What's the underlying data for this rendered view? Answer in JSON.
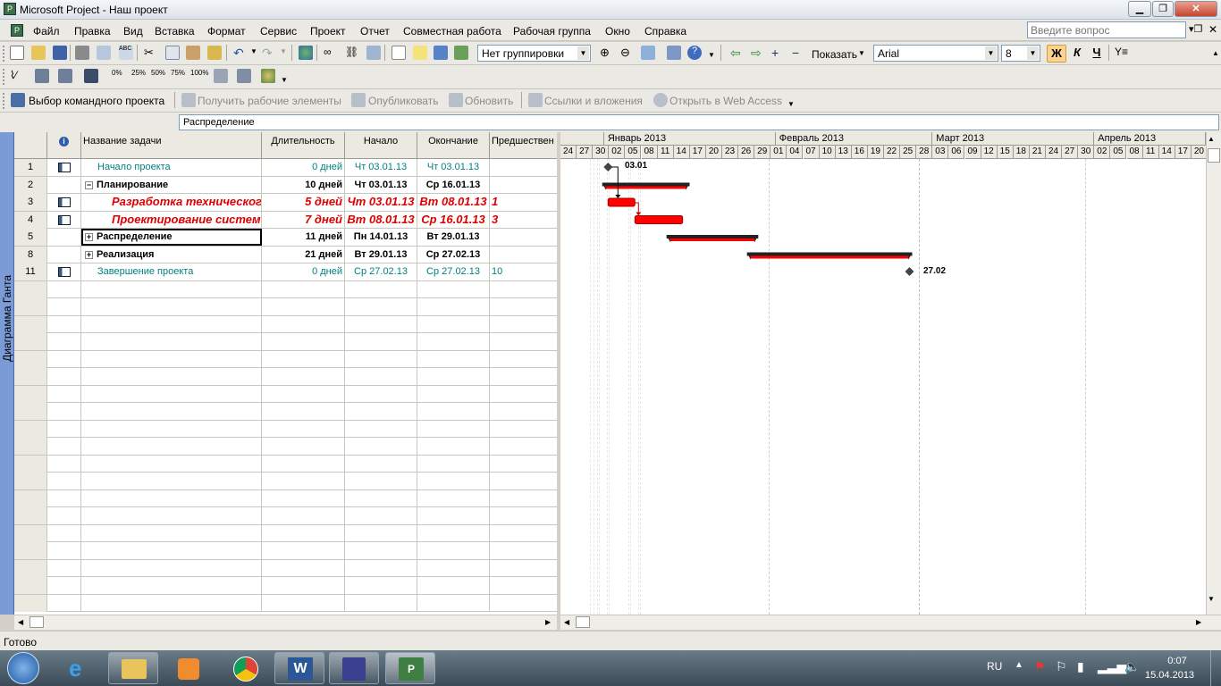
{
  "window": {
    "title": "Microsoft Project - Наш проект"
  },
  "menu": [
    "Файл",
    "Правка",
    "Вид",
    "Вставка",
    "Формат",
    "Сервис",
    "Проект",
    "Отчет",
    "Совместная работа",
    "Рабочая группа",
    "Окно",
    "Справка"
  ],
  "help_box": {
    "placeholder": "Введите вопрос"
  },
  "toolbar": {
    "grouping": "Нет группировки",
    "show_label": "Показать",
    "font": "Arial",
    "font_size": "8",
    "bold": "Ж",
    "italic": "К",
    "underline": "Ч",
    "pcts": [
      "0%",
      "25%",
      "50%",
      "75%",
      "100%"
    ]
  },
  "team_toolbar": {
    "select_project": "Выбор командного проекта",
    "get_items": "Получить рабочие элементы",
    "publish": "Опубликовать",
    "refresh": "Обновить",
    "links": "Ссылки и вложения",
    "web_access": "Открыть в Web Access"
  },
  "entry": {
    "value": "Распределение"
  },
  "view_label": "Диаграмма Ганта",
  "columns": {
    "info": "i",
    "name": "Название задачи",
    "duration": "Длительность",
    "start": "Начало",
    "finish": "Окончание",
    "pred": "Предшествен"
  },
  "tasks": [
    {
      "id": "1",
      "name": "Начало проекта",
      "duration": "0 дней",
      "start": "Чт 03.01.13",
      "finish": "Чт 03.01.13",
      "pred": "",
      "style": "teal",
      "icon": true,
      "expand": ""
    },
    {
      "id": "2",
      "name": "Планирование",
      "duration": "10 дней",
      "start": "Чт 03.01.13",
      "finish": "Ср 16.01.13",
      "pred": "",
      "style": "bold",
      "icon": false,
      "expand": "−"
    },
    {
      "id": "3",
      "name": "Разработка техническог",
      "duration": "5 дней",
      "start": "Чт 03.01.13",
      "finish": "Вт 08.01.13",
      "pred": "1",
      "style": "crit",
      "icon": true,
      "expand": ""
    },
    {
      "id": "4",
      "name": "Проектирование систем",
      "duration": "7 дней",
      "start": "Вт 08.01.13",
      "finish": "Ср 16.01.13",
      "pred": "3",
      "style": "crit",
      "icon": true,
      "expand": ""
    },
    {
      "id": "5",
      "name": "Распределение",
      "duration": "11 дней",
      "start": "Пн 14.01.13",
      "finish": "Вт 29.01.13",
      "pred": "",
      "style": "bold",
      "icon": false,
      "expand": "+"
    },
    {
      "id": "8",
      "name": "Реализация",
      "duration": "21 дней",
      "start": "Вт 29.01.13",
      "finish": "Ср 27.02.13",
      "pred": "",
      "style": "bold",
      "icon": false,
      "expand": "+"
    },
    {
      "id": "11",
      "name": "Завершение проекта",
      "duration": "0 дней",
      "start": "Ср 27.02.13",
      "finish": "Ср 27.02.13",
      "pred": "10",
      "style": "teal",
      "icon": true,
      "expand": ""
    }
  ],
  "timescale": {
    "months": [
      "Январь 2013",
      "Февраль 2013",
      "Март 2013",
      "Апрель 2013"
    ],
    "days": [
      "24",
      "27",
      "30",
      "02",
      "05",
      "08",
      "11",
      "14",
      "17",
      "20",
      "23",
      "26",
      "29",
      "01",
      "04",
      "07",
      "10",
      "13",
      "16",
      "19",
      "22",
      "25",
      "28",
      "03",
      "06",
      "09",
      "12",
      "15",
      "18",
      "21",
      "24",
      "27",
      "30",
      "02",
      "05",
      "08",
      "11",
      "14",
      "17",
      "20"
    ]
  },
  "gantt_labels": {
    "start_milestone": "03.01",
    "end_milestone": "27.02"
  },
  "status": "Готово",
  "tray": {
    "lang": "RU",
    "time": "0:07",
    "date": "15.04.2013"
  }
}
